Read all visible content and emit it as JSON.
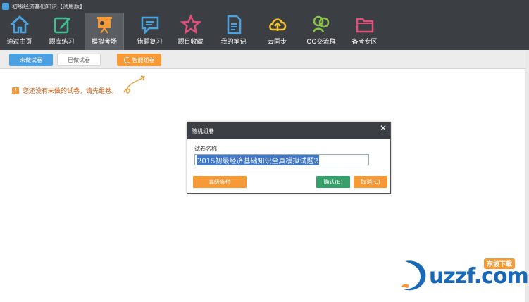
{
  "app": {
    "title": "初级经济基础知识【试用版】"
  },
  "toolbar": {
    "items": [
      {
        "label": "速过主页",
        "icon": "home-icon"
      },
      {
        "label": "题库练习",
        "icon": "edit-icon"
      },
      {
        "label": "模拟考场",
        "icon": "presentation-icon",
        "active": true
      },
      {
        "label": "错题复习",
        "icon": "chat-icon"
      },
      {
        "label": "题目收藏",
        "icon": "star-icon"
      },
      {
        "label": "我的笔记",
        "icon": "note-icon"
      },
      {
        "label": "云同步",
        "icon": "cloud-upload-icon"
      },
      {
        "label": "QQ交流群",
        "icon": "group-icon"
      },
      {
        "label": "备考专区",
        "icon": "folder-icon"
      }
    ]
  },
  "tabs": {
    "undone": "未做试卷",
    "done": "已做试卷",
    "smart": "智能组卷"
  },
  "notice": {
    "icon": "!",
    "text": "您还没有未做的试卷，请先组卷。"
  },
  "dialog": {
    "title": "随机组卷",
    "close": "✕",
    "name_label": "试卷名称:",
    "name_value": "2015初级经济基础知识全真模拟试题2",
    "advanced_button": "高级条件",
    "ok_button": "确认(E)",
    "cancel_button": "取消(C)"
  },
  "watermark": {
    "brand": "uzzf.com",
    "tag": "东坡下载"
  },
  "colors": {
    "dark": "#3b3f44",
    "accent_orange": "#f59a36",
    "accent_blue": "#4aa0e0",
    "accent_green": "#37a06a"
  }
}
